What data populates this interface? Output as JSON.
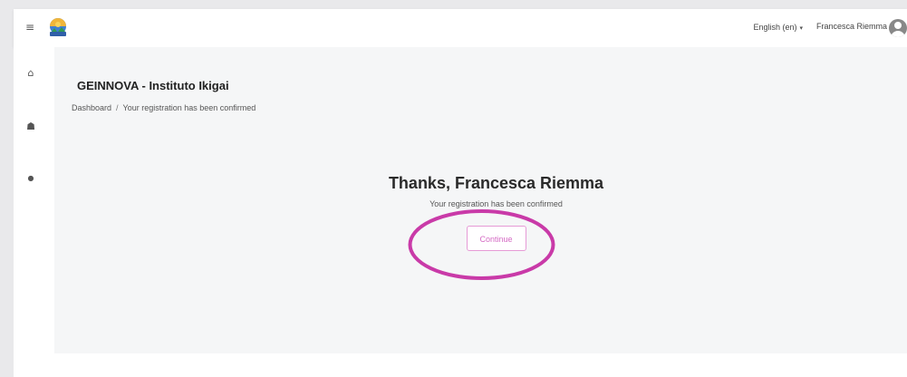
{
  "navbar": {
    "menu_icon": "hamburger-icon",
    "language": "English (en)",
    "language_caret": "▾",
    "user_name": "Francesca Riemma"
  },
  "sidebar": {
    "items": [
      {
        "icon": "home-icon",
        "glyph": "⌂"
      },
      {
        "icon": "user-icon",
        "glyph": "☗"
      },
      {
        "icon": "dot-icon",
        "glyph": "●"
      }
    ]
  },
  "page": {
    "site_title": "GEINNOVA - Instituto Ikigai",
    "breadcrumb": {
      "home": "Dashboard",
      "separator": "/",
      "current": "Your registration has been confirmed"
    },
    "heading": "Thanks, Francesca Riemma",
    "message": "Your registration has been confirmed",
    "continue_label": "Continue"
  },
  "colors": {
    "accent": "#d56bc4",
    "highlight": "#c93aa8"
  }
}
